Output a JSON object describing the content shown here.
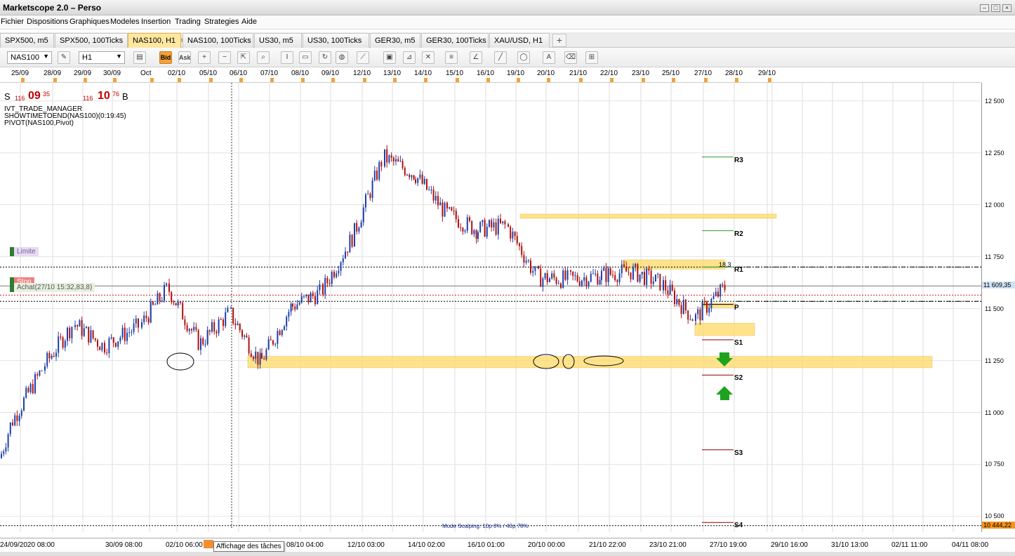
{
  "app": {
    "title": "Marketscope 2.0 – Perso",
    "window_buttons": [
      "–",
      "□",
      "×"
    ]
  },
  "menu": [
    "Fichier",
    "Dispositions",
    "Graphiques",
    "Modeles",
    "Insertion",
    "Trading",
    "Strategies",
    "Aide"
  ],
  "tabs": [
    {
      "label": "SPX500, m5",
      "active": false
    },
    {
      "label": "SPX500, 100Ticks",
      "active": false
    },
    {
      "label": "NAS100, H1",
      "active": true
    },
    {
      "label": "NAS100, 100Ticks",
      "active": false
    },
    {
      "label": "US30, m5",
      "active": false
    },
    {
      "label": "US30, 100Ticks",
      "active": false
    },
    {
      "label": "GER30, m5",
      "active": false
    },
    {
      "label": "GER30, 100Ticks",
      "active": false
    },
    {
      "label": "XAU/USD, H1",
      "active": false
    }
  ],
  "tab_close_glyph": "×",
  "tab_add_glyph": "+",
  "toolbar": {
    "instrument": "NAS100",
    "timeframe": "H1",
    "bid_label": "Bid",
    "ask_label": "Ask",
    "icons": [
      "eraser-icon",
      "bar-chart-icon",
      "zoom-in-icon",
      "zoom-out-icon",
      "zoom-fit-icon",
      "cursor-icon",
      "crosshair-icon",
      "magnifier-icon",
      "note-icon",
      "refresh-icon",
      "globe-icon",
      "ruler-icon",
      "image-icon",
      "pin-icon",
      "fibonacci-icon",
      "lines-icon",
      "trendline-icon",
      "line-icon",
      "shape-icon",
      "text-icon",
      "delete-icon",
      "tree-icon"
    ]
  },
  "date_header": [
    "25/09",
    "28/09",
    "29/09",
    "30/09",
    "Oct",
    "02/10",
    "05/10",
    "06/10",
    "07/10",
    "08/10",
    "09/10",
    "12/10",
    "13/10",
    "14/10",
    "15/10",
    "16/10",
    "19/10",
    "20/10",
    "21/10",
    "22/10",
    "23/10",
    "25/10",
    "27/10",
    "28/10",
    "29/10"
  ],
  "quote": {
    "sell_letter": "S",
    "sell_prefix": "116",
    "sell_main": "09",
    "sell_sup": "35",
    "buy_prefix": "116",
    "buy_main": "10",
    "buy_sup": "76",
    "buy_letter": "B"
  },
  "indicators": [
    "IVT_TRADE_MANAGER",
    "SHOWTIMETOEND(NAS100)(0:19:45)",
    "PIVOT(NAS100,Pivot)"
  ],
  "orders": {
    "limit_label": "Limite",
    "stop_label": "Stop",
    "buy_label": "Achat(27/10 15:32,83,8)",
    "counter_label": "18,3"
  },
  "pivots": [
    "R3",
    "R2",
    "R1",
    "P",
    "S1",
    "S2",
    "S3",
    "S4"
  ],
  "price_axis": {
    "ticks": [
      "12 500",
      "12 250",
      "12 000",
      "11 750",
      "11 500",
      "11 250",
      "11 000",
      "10 750",
      "10 500"
    ],
    "current_price": "11 609,35",
    "low_marker": "10 444,22"
  },
  "time_axis": [
    "24/09/2020 08:00",
    "30/09 08:00",
    "02/10 06:00",
    "05/",
    "08/10 04:00",
    "12/10 03:00",
    "14/10 02:00",
    "16/10 01:00",
    "20/10 00:00",
    "21/10 22:00",
    "23/10 21:00",
    "27/10 19:00",
    "29/10 16:00",
    "31/10 13:00",
    "02/11 11:00",
    "04/11 08:00"
  ],
  "tooltip": "Affichage des tâches",
  "mode_text": "Mode Scalping: 10p 0% / 40p 78%",
  "colors": {
    "bull": "#1f3fa8",
    "bear": "#b01010",
    "zone": "#ffd966",
    "r_line": "#2e9e2e",
    "s_line": "#8b0000",
    "accent_tab": "#ffe7a1",
    "current_price_box": "#cfe2f3",
    "low_marker_box": "#f7941d"
  },
  "chart_data": {
    "type": "candlestick",
    "timeframe": "H1",
    "instrument": "NAS100",
    "ylim": [
      10444,
      12560
    ],
    "x_range": [
      "24/09/2020 08:00",
      "04/11 08:00"
    ],
    "close_path": [
      {
        "t": "24/09/2020 08:00",
        "price": 10780
      },
      {
        "t": "25/09",
        "price": 10950
      },
      {
        "t": "28/09",
        "price": 11220
      },
      {
        "t": "29/09",
        "price": 11430
      },
      {
        "t": "30/09 08:00",
        "price": 11320
      },
      {
        "t": "Oct",
        "price": 11420
      },
      {
        "t": "02/10 06:00",
        "price": 11600
      },
      {
        "t": "05/10",
        "price": 11330
      },
      {
        "t": "06/10",
        "price": 11480
      },
      {
        "t": "07/10",
        "price": 11240
      },
      {
        "t": "08/10 04:00",
        "price": 11510
      },
      {
        "t": "09/10",
        "price": 11580
      },
      {
        "t": "12/10 03:00",
        "price": 11850
      },
      {
        "t": "13/10",
        "price": 12230
      },
      {
        "t": "14/10 02:00",
        "price": 12150
      },
      {
        "t": "15/10",
        "price": 11960
      },
      {
        "t": "16/10 01:00",
        "price": 11880
      },
      {
        "t": "19/10",
        "price": 11900
      },
      {
        "t": "20/10 00:00",
        "price": 11650
      },
      {
        "t": "21/10 22:00",
        "price": 11640
      },
      {
        "t": "22/10",
        "price": 11660
      },
      {
        "t": "23/10 21:00",
        "price": 11680
      },
      {
        "t": "25/10",
        "price": 11620
      },
      {
        "t": "27/10",
        "price": 11450
      },
      {
        "t": "27/10 19:00",
        "price": 11610
      }
    ],
    "pivot_levels": [
      {
        "name": "R3",
        "price": 12230
      },
      {
        "name": "R2",
        "price": 11875
      },
      {
        "name": "R1",
        "price": 11700
      },
      {
        "name": "P",
        "price": 11520
      },
      {
        "name": "S1",
        "price": 11350
      },
      {
        "name": "S2",
        "price": 11180
      },
      {
        "name": "S3",
        "price": 10820
      },
      {
        "name": "S4",
        "price": 10470
      }
    ],
    "zones": [
      {
        "x_from": "19/10",
        "x_to": "29/10",
        "y_from": 11955,
        "y_to": 11935
      },
      {
        "x_from": "22/10",
        "x_to": "27/10",
        "y_from": 11735,
        "y_to": 11690
      },
      {
        "x_from": "27/10",
        "x_to": "28/10",
        "y_from": 11525,
        "y_to": 11505
      },
      {
        "x_from": "27/10",
        "x_to": "28/10",
        "y_from": 11430,
        "y_to": 11370
      },
      {
        "x_from": "06/10",
        "x_to": "02/11 11:00",
        "y_from": 11270,
        "y_to": 11215
      }
    ],
    "order_lines": [
      {
        "label": "Limite",
        "price": 11700
      },
      {
        "label": "Stop",
        "price": 11609
      },
      {
        "label": "Achat",
        "price": 11535
      }
    ],
    "grid": true
  }
}
